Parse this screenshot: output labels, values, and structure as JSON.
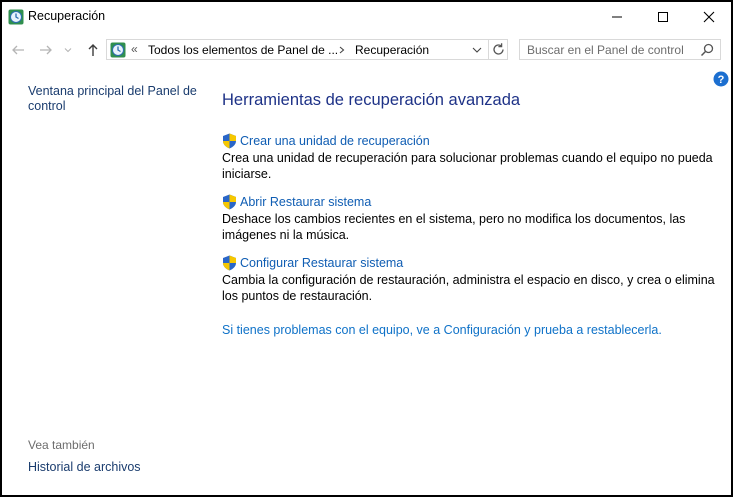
{
  "window": {
    "title": "Recuperación"
  },
  "nav": {
    "address": {
      "overflow": "«",
      "crumbs": [
        "Todos los elementos de Panel de ...",
        "Recuperación"
      ]
    },
    "search_placeholder": "Buscar en el Panel de control"
  },
  "sidebar": {
    "home_link": "Ventana principal del Panel de control",
    "see_also_label": "Vea también",
    "see_also_items": [
      "Historial de archivos"
    ]
  },
  "main": {
    "heading": "Herramientas de recuperación avanzada",
    "tasks": [
      {
        "link": "Crear una unidad de recuperación",
        "description": "Crea una unidad de recuperación para solucionar problemas cuando el equipo no pueda iniciarse."
      },
      {
        "link": "Abrir Restaurar sistema",
        "description": "Deshace los cambios recientes en el sistema, pero no modifica los documentos, las imágenes ni la música."
      },
      {
        "link": "Configurar Restaurar sistema",
        "description": "Cambia la configuración de restauración, administra el espacio en disco, y crea o elimina los puntos de restauración."
      }
    ],
    "reset_link": "Si tienes problemas con el equipo, ve a Configuración y prueba a restablecerla."
  },
  "icons": {
    "app": "recovery-icon",
    "back": "back-arrow-icon",
    "forward": "forward-arrow-icon",
    "recent": "chevron-down-icon",
    "up": "up-arrow-icon",
    "refresh": "refresh-icon",
    "search": "search-icon",
    "help": "help-icon",
    "shield": "uac-shield-icon"
  },
  "colors": {
    "link": "#0f5db3",
    "heading": "#1e3287",
    "help": "#1c6fd0"
  }
}
